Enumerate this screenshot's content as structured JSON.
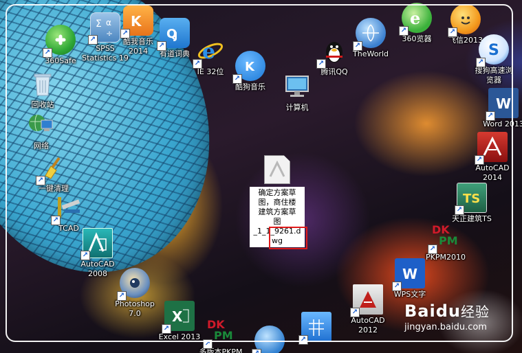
{
  "desktop_icons": [
    {
      "id": "360safe",
      "label": "360Safe",
      "icon": "360safe-icon",
      "color": "#2fa836"
    },
    {
      "id": "spss",
      "label": "SPSS\nStatistics 19",
      "icon": "spss-icon",
      "color": "#6aa0d0"
    },
    {
      "id": "kugou2014",
      "label": "酷我音乐\n2014",
      "icon": "kuwo-icon",
      "color": "#f08a1c"
    },
    {
      "id": "youdao",
      "label": "有道词典",
      "icon": "youdao-icon",
      "color": "#2e8fe0"
    },
    {
      "id": "ie32",
      "label": "IE 32位",
      "icon": "ie-icon",
      "color": "#1e7fd8"
    },
    {
      "id": "kugou",
      "label": "酷狗音乐",
      "icon": "kugou-icon",
      "color": "#1b78d6"
    },
    {
      "id": "qq",
      "label": "腾讯QQ",
      "icon": "qq-penguin-icon",
      "color": "#111111"
    },
    {
      "id": "theworld",
      "label": "TheWorld",
      "icon": "theworld-icon",
      "color": "#3a7fd0"
    },
    {
      "id": "360browser",
      "label": "360览器",
      "icon": "360browser-icon",
      "color": "#3bb13b"
    },
    {
      "id": "feixin",
      "label": "飞信2013",
      "icon": "feixin-icon",
      "color": "#f39a1e"
    },
    {
      "id": "sogou",
      "label": "搜狗高速浏\n览器",
      "icon": "sogou-browser-icon",
      "color": "#1a6fd0"
    },
    {
      "id": "recycle",
      "label": "回收站",
      "icon": "recycle-bin-icon",
      "color": "#9ab8d0"
    },
    {
      "id": "computer",
      "label": "计算机",
      "icon": "computer-icon",
      "color": "#3a86c8"
    },
    {
      "id": "word",
      "label": "Word 2013",
      "icon": "word-icon",
      "color": "#2b5797"
    },
    {
      "id": "network",
      "label": "网络",
      "icon": "network-icon",
      "color": "#2f7fd0"
    },
    {
      "id": "cleanup",
      "label": "一键清理",
      "icon": "broom-icon",
      "color": "#e0b020"
    },
    {
      "id": "autocad2014",
      "label": "AutoCAD\n2014",
      "icon": "autocad-icon",
      "color": "#c0201c"
    },
    {
      "id": "tcad",
      "label": "TCAD",
      "icon": "tcad-icon",
      "color": "#c0a020"
    },
    {
      "id": "tzts",
      "label": "天正建筑TS",
      "icon": "tangent-ts-icon",
      "color": "#2e7f5e"
    },
    {
      "id": "autocad2008",
      "label": "AutoCAD\n2008",
      "icon": "autocad-2008-icon",
      "color": "#1aa0a0"
    },
    {
      "id": "pkpm2010",
      "label": "PKPM2010",
      "icon": "pkpm-icon",
      "color": "#d01a2a"
    },
    {
      "id": "photoshop",
      "label": "Photoshop\n7.0",
      "icon": "photoshop-icon",
      "color": "#3a6fb0"
    },
    {
      "id": "wps",
      "label": "WPS文字",
      "icon": "wps-writer-icon",
      "color": "#1e5fc8"
    },
    {
      "id": "excel",
      "label": "Excel 2013",
      "icon": "excel-icon",
      "color": "#1e7145"
    },
    {
      "id": "pkpm-old",
      "label": "多版本PKPM",
      "icon": "pkpm-multi-icon",
      "color": "#d01a2a"
    },
    {
      "id": "autocad2012",
      "label": "AutoCAD\n2012",
      "icon": "autocad-2012-icon",
      "color": "#c0201c"
    },
    {
      "id": "network2",
      "label": "",
      "icon": "globe-icon",
      "color": "#2f7fd0"
    },
    {
      "id": "tile",
      "label": "",
      "icon": "tile-grid-icon",
      "color": "#2f8fe0"
    }
  ],
  "selected_file": {
    "label": "确定方案草\n图，商住楼\n建筑方案草\n图\n_1_1_9261.d\nwg",
    "icon": "dwg-file-icon"
  },
  "watermark": {
    "brand": "Baidu",
    "brand_cn": "经验",
    "url": "jingyan.baidu.com"
  },
  "colors": {
    "highlight": "#e01a1a",
    "frame": "#ffffff"
  }
}
